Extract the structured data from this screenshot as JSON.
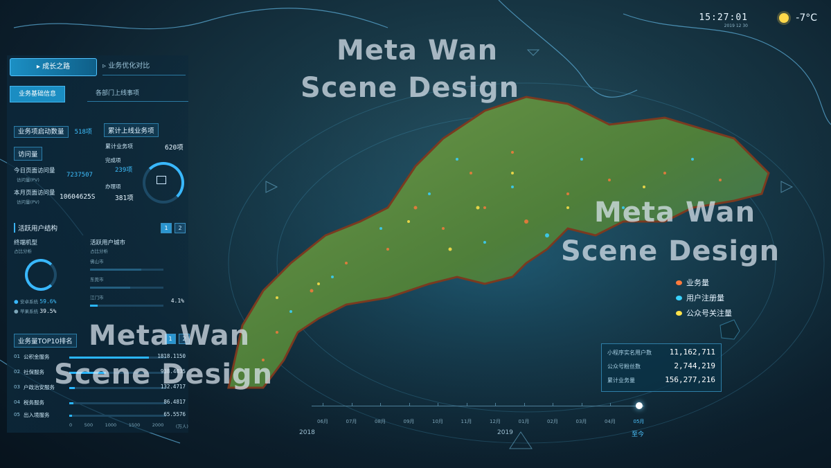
{
  "header": {
    "time": "15:27:01",
    "date": "2019 12 30",
    "weather_icon": "sun-icon",
    "temperature": "-7°C"
  },
  "left": {
    "tabs": [
      {
        "label": "成长之路",
        "active": true
      },
      {
        "label": "业务优化对比",
        "active": false
      }
    ],
    "subtabs": [
      {
        "label": "业务基础信息",
        "active": true
      },
      {
        "label": "各部门上线事项",
        "active": false
      }
    ],
    "business_count": {
      "label": "业务项启动数量",
      "value": "518项"
    },
    "visits": {
      "title": "访问量",
      "today_label": "今日页面访问量",
      "today_unit": "访问量(PV)",
      "today_value": "7237507",
      "month_label": "本月页面访问量",
      "month_unit": "访问量(PV)",
      "month_value": "10604625S"
    },
    "online": {
      "title": "累计上线业务项",
      "total_label": "累计业务项",
      "total_value": "620项",
      "done_label": "完成项",
      "done_value": "239项",
      "progress_label": "办理项",
      "progress_value": "381项"
    },
    "active_users": {
      "title": "活跃用户结构",
      "pager": [
        "1",
        "2"
      ],
      "terminal_title": "终端机型",
      "terminal_sub": "占比分析",
      "city_title": "活跃用户城市",
      "city_sub": "占比分析",
      "cities": [
        {
          "name": "佛山市",
          "percent": 70,
          "value": ""
        },
        {
          "name": "东莞市",
          "percent": 55,
          "value": ""
        },
        {
          "name": "江门市",
          "percent": 10,
          "value": "4.1%"
        }
      ],
      "android": {
        "label": "安卓系统",
        "value": "59.6%"
      },
      "apple": {
        "label": "苹果系统",
        "value": "39.5%"
      }
    },
    "top10": {
      "title": "业务量TOP10排名",
      "pager": [
        "1",
        "2"
      ],
      "rows": [
        {
          "rank": "01",
          "name": "公积金服务",
          "value": "1818.1150",
          "ratio": 0.82
        },
        {
          "rank": "02",
          "name": "社保服务",
          "value": "938.4035",
          "ratio": 0.38
        },
        {
          "rank": "03",
          "name": "户政治安服务",
          "value": "132.4717",
          "ratio": 0.06
        },
        {
          "rank": "04",
          "name": "税务服务",
          "value": "86.4817",
          "ratio": 0.04
        },
        {
          "rank": "05",
          "name": "出入境服务",
          "value": "65.5576",
          "ratio": 0.03
        }
      ],
      "axis": [
        "0",
        "500",
        "1000",
        "1500",
        "2000",
        "(万人)"
      ]
    }
  },
  "legend": [
    {
      "label": "业务量",
      "color": "#ff7a3c"
    },
    {
      "label": "用户注册量",
      "color": "#39d2ff"
    },
    {
      "label": "公众号关注量",
      "color": "#ffe24a"
    }
  ],
  "stats": [
    {
      "label": "小程序实名用户数",
      "value": "11,162,711"
    },
    {
      "label": "公众号粉丝数",
      "value": "2,744,219"
    },
    {
      "label": "累计业务量",
      "value": "156,277,216"
    }
  ],
  "timeline": {
    "months": [
      "06月",
      "07月",
      "08月",
      "09月",
      "10月",
      "11月",
      "12月",
      "01月",
      "02月",
      "03月",
      "04月",
      "05月"
    ],
    "active_month_index": 11,
    "years": [
      "2018",
      "2019"
    ],
    "current": "至今"
  },
  "watermark": {
    "line1": "Meta Wan",
    "line2": "Scene Design"
  }
}
